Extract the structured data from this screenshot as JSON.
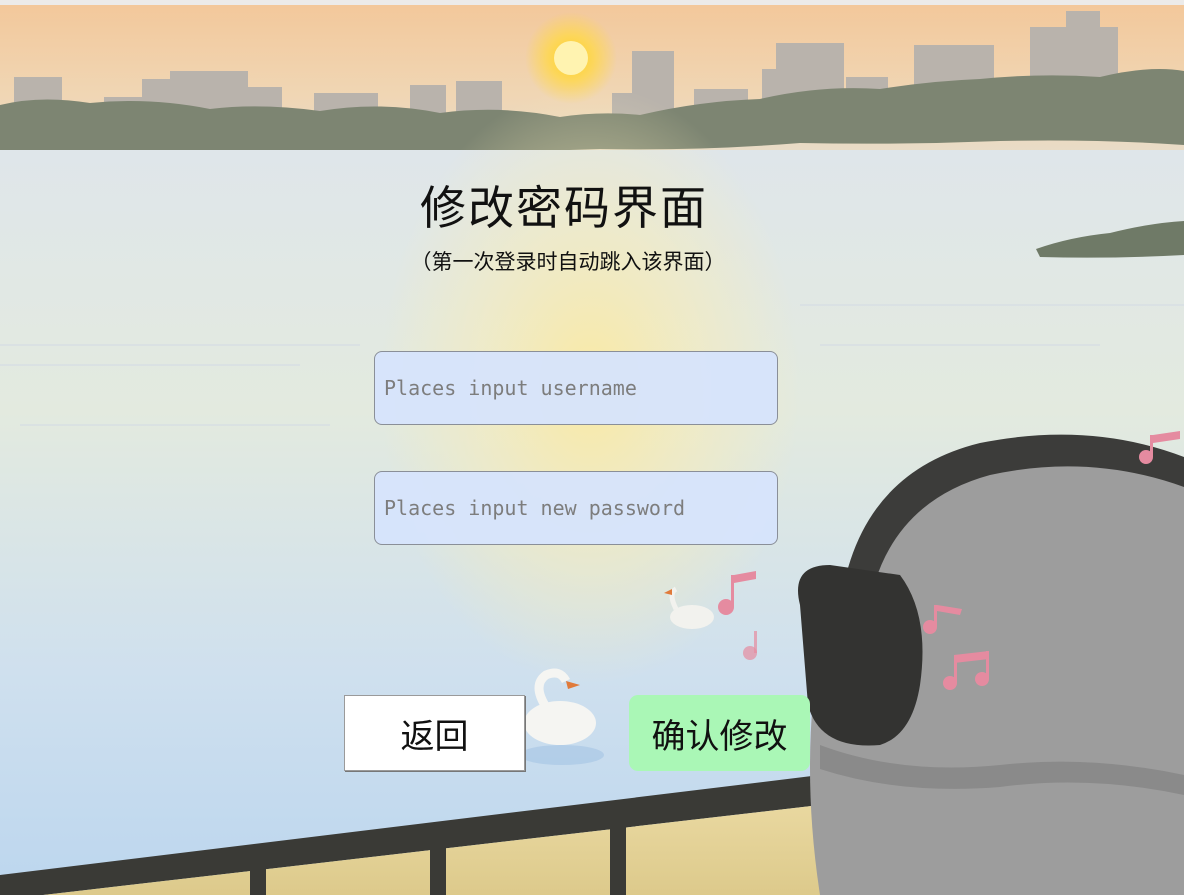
{
  "page": {
    "title": "修改密码界面",
    "subtitle": "（第一次登录时自动跳入该界面）"
  },
  "form": {
    "username_placeholder": "Places input username",
    "username_value": "",
    "password_placeholder": "Places input new password",
    "password_value": ""
  },
  "buttons": {
    "back_label": "返回",
    "confirm_label": "确认修改"
  },
  "colors": {
    "input_background": "#d6e4fc",
    "confirm_button": "#aaf7b6",
    "back_button": "#ffffff"
  }
}
